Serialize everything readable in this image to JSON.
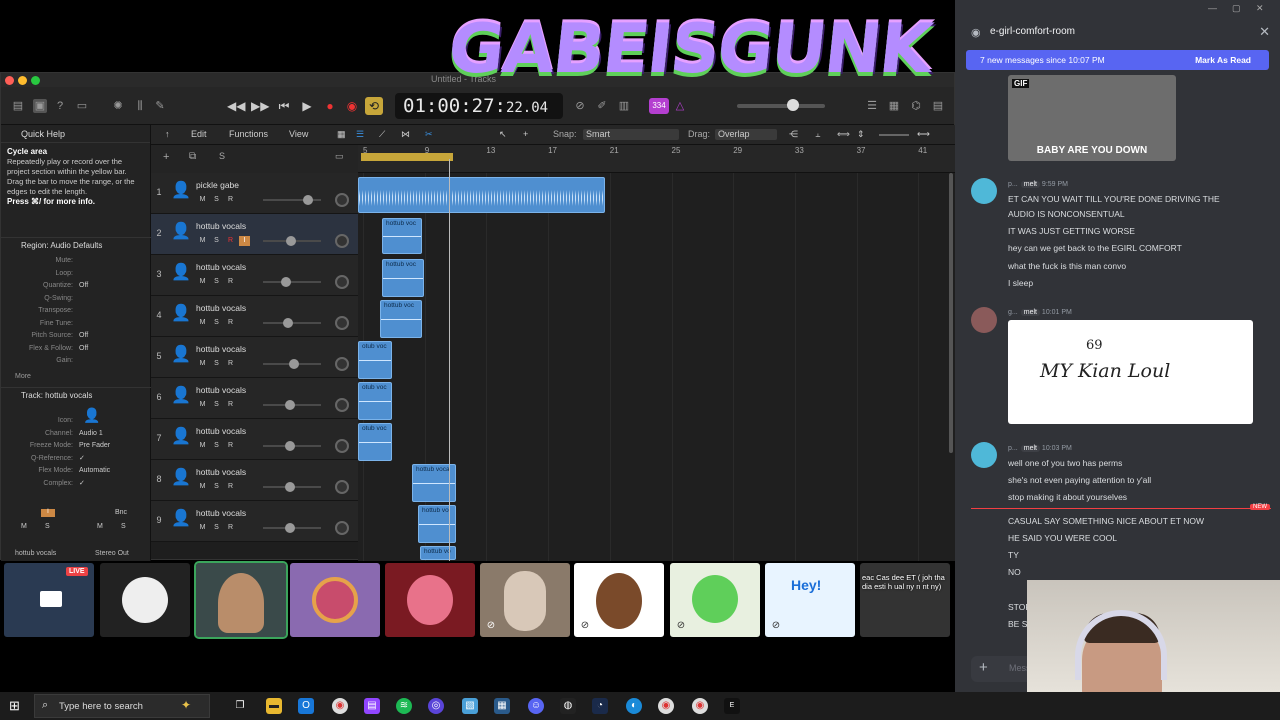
{
  "overlay": {
    "logo_text": "GABEISGUNK"
  },
  "daw": {
    "window_title": "Untitled - Tracks",
    "counter_main": "01:00:27:",
    "counter_frames": "22.04",
    "badge": "334",
    "toolbar": {
      "edit": "Edit",
      "functions": "Functions",
      "view": "View",
      "snap_label": "Snap:",
      "snap_value": "Smart",
      "drag_label": "Drag:",
      "drag_value": "Overlap"
    },
    "quick_help": {
      "title": "Quick Help",
      "heading": "Cycle area",
      "body": "Repeatedly play or record over the project section within the yellow bar. Drag the bar to move the range, or the edges to edit the length.",
      "more": "Press ⌘/ for more info."
    },
    "region_section": {
      "label": "Region:",
      "value": "Audio Defaults"
    },
    "region_params": [
      {
        "k": "Mute:",
        "v": ""
      },
      {
        "k": "Loop:",
        "v": ""
      },
      {
        "k": "Quantize:",
        "v": "Off"
      },
      {
        "k": "Q-Swing:",
        "v": ""
      },
      {
        "k": "Transpose:",
        "v": ""
      },
      {
        "k": "Fine Tune:",
        "v": ""
      },
      {
        "k": "Pitch Source:",
        "v": "Off"
      },
      {
        "k": "Flex & Follow:",
        "v": "Off"
      },
      {
        "k": "Gain:",
        "v": ""
      }
    ],
    "more_label": "More",
    "track_section": {
      "label": "Track:",
      "value": "hottub vocals"
    },
    "track_params": [
      {
        "k": "Icon:",
        "v": ""
      },
      {
        "k": "Channel:",
        "v": "Audio 1"
      },
      {
        "k": "Freeze Mode:",
        "v": "Pre Fader"
      },
      {
        "k": "Q-Reference:",
        "v": "✓"
      },
      {
        "k": "Flex Mode:",
        "v": "Automatic"
      },
      {
        "k": "Complex:",
        "v": "✓"
      }
    ],
    "strip_left_name": "hottub vocals",
    "strip_right_name": "Stereo Out",
    "strip_bnc": "Bnc",
    "ruler": [
      "5",
      "9",
      "13",
      "17",
      "21",
      "25",
      "29",
      "33",
      "37",
      "41"
    ],
    "tracks": [
      {
        "num": "1",
        "name": "pickle gabe"
      },
      {
        "num": "2",
        "name": "hottub vocals"
      },
      {
        "num": "3",
        "name": "hottub vocals"
      },
      {
        "num": "4",
        "name": "hottub vocals"
      },
      {
        "num": "5",
        "name": "hottub vocals"
      },
      {
        "num": "6",
        "name": "hottub vocals"
      },
      {
        "num": "7",
        "name": "hottub vocals"
      },
      {
        "num": "8",
        "name": "hottub vocals"
      },
      {
        "num": "9",
        "name": "hottub vocals"
      }
    ],
    "track_buttons": [
      "M",
      "S",
      "R",
      "I"
    ],
    "region_labels": {
      "r2": "hottub voc",
      "r3": "hottub voc",
      "r4": "hottub voc",
      "r5": "otub voc",
      "r6": "otub voc",
      "r7": "otub voc",
      "r8": "hottub voca",
      "r9": "hottub vo",
      "r10": "hottub vo"
    }
  },
  "tiles": {
    "live": "LIVE",
    "hey": "Hey!",
    "caption": "eac Cas dee ET ( joh tha dia esti h ual ny n nt ny)"
  },
  "chat": {
    "channel": "e-girl-comfort-room",
    "new_messages": "7 new messages since 10:07 PM",
    "mark_read": "Mark As Read",
    "gif_tag": "GIF",
    "gif_caption": "BABY ARE YOU DOWN",
    "msg1_author": "p...",
    "msg1_role": "melt",
    "msg1_time": "9:59 PM",
    "msg1_lines": [
      "ET CAN YOU WAIT TILL YOU'RE DONE DRIVING THE",
      "AUDIO IS NONCONSENTUAL",
      "IT WAS JUST GETTING WORSE",
      "hey can we get back to the EGIRL COMFORT",
      "what the fuck is this man convo",
      "I sleep"
    ],
    "msg2_author": "g...",
    "msg2_role": "melt",
    "msg2_time": "10:01 PM",
    "drawing_text": "69",
    "drawing_text2": "MY Kian Loul",
    "msg3_author": "p...",
    "msg3_role": "melt",
    "msg3_time": "10:03 PM",
    "msg3_lines": [
      "well one of you two has perms",
      "she's not even paying attention to y'all",
      "stop making it about yourselves"
    ],
    "new_tag": "NEW",
    "msg4_lines": [
      "CASUAL SAY SOMETHING NICE ABOUT ET NOW",
      "HE SAID YOU WERE COOL",
      "TY",
      "NO",
      "STOP",
      "BE SERIO"
    ],
    "input_placeholder": "Message"
  },
  "taskbar": {
    "search_placeholder": "Type here to search"
  }
}
